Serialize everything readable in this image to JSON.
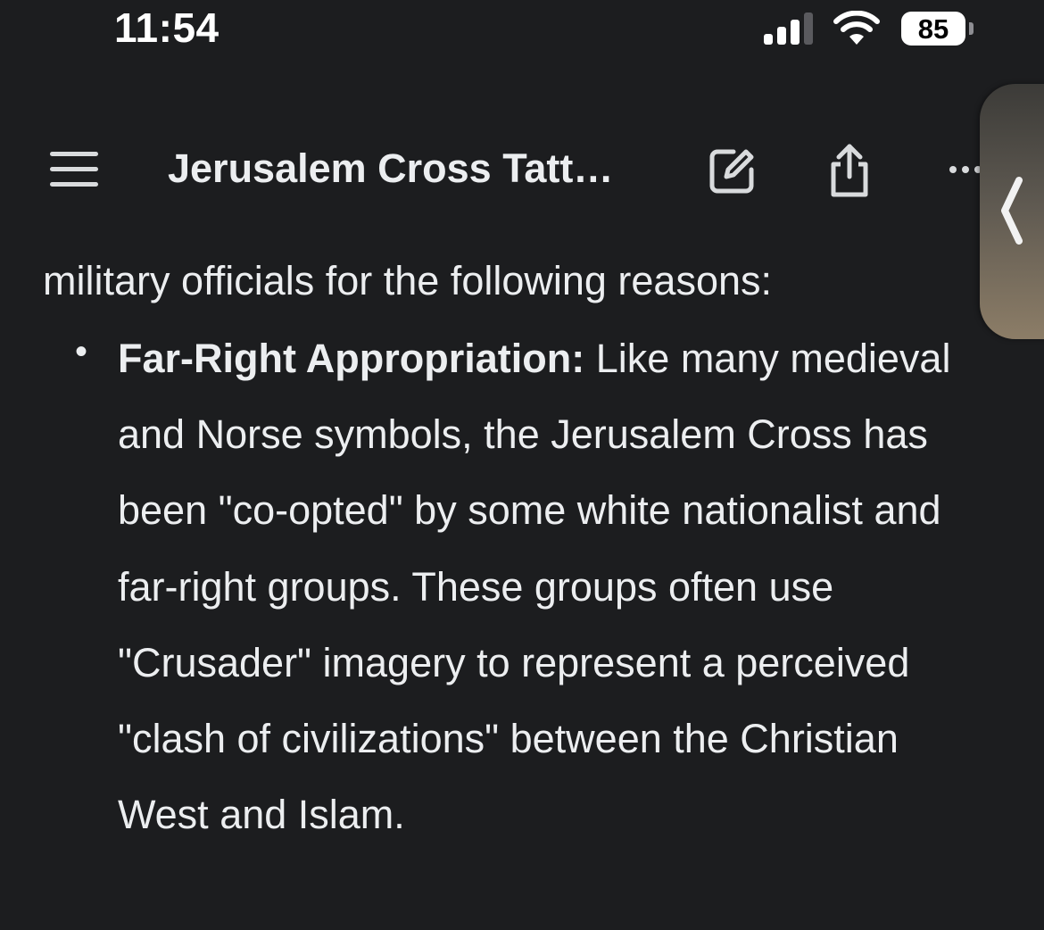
{
  "status_bar": {
    "time": "11:54",
    "battery_level": "85",
    "icons": [
      "signal-icon",
      "wifi-icon",
      "battery-icon"
    ]
  },
  "header": {
    "title": "Jerusalem Cross Tatt…",
    "icons": [
      "menu-icon",
      "edit-icon",
      "share-icon",
      "more-icon"
    ]
  },
  "side_handle": {
    "icon": "chevron-left-icon"
  },
  "content": {
    "intro_text": "military officials for the following reasons:",
    "bullets": [
      {
        "heading": "Far-Right Appropriation:",
        "text": " Like many medieval and Norse symbols, the Jerusalem Cross has been \"co-opted\" by some white nationalist and far-right groups. These groups often use \"Crusader\" imagery to represent a perceived \"clash of civilizations\" between the Christian West and Islam."
      }
    ]
  },
  "colors": {
    "background": "#1c1d1f",
    "text": "#eceef0",
    "icon": "#d9dbdd",
    "handle": "#8c7d67"
  }
}
